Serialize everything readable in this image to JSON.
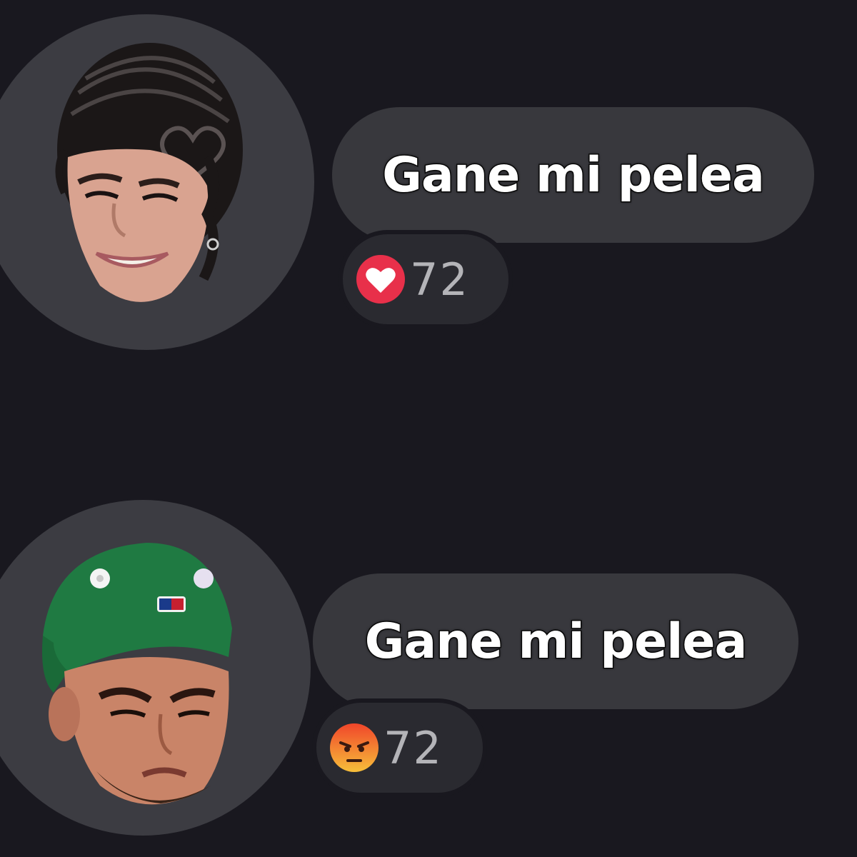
{
  "messages": [
    {
      "text": "Gane mi pelea",
      "reaction": {
        "icon": "heart-reaction-icon",
        "color": "#e8304a",
        "count": "72"
      }
    },
    {
      "text": "Gane mi pelea",
      "reaction": {
        "icon": "angry-reaction-icon",
        "color": "#f0562c",
        "count": "72"
      }
    }
  ]
}
